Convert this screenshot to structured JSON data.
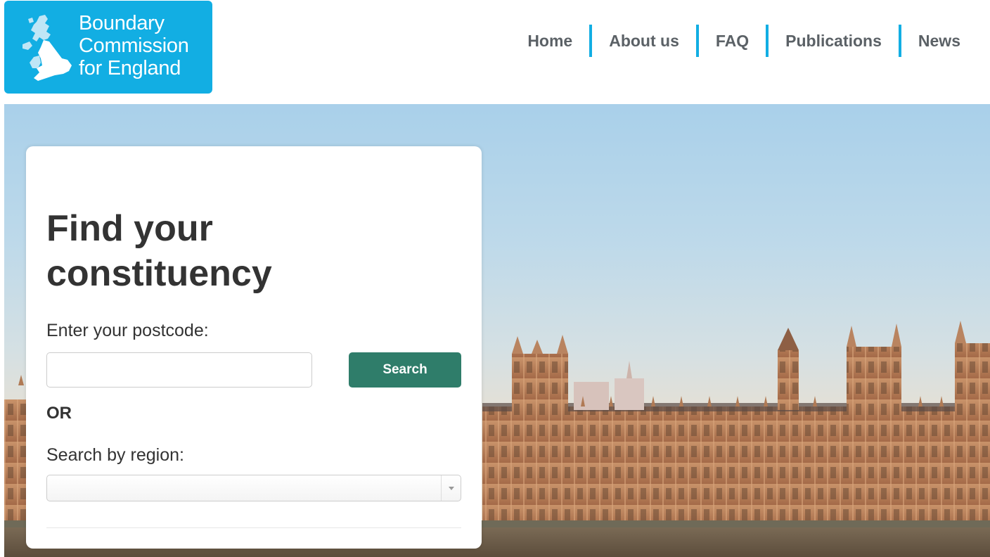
{
  "logo": {
    "line1": "Boundary",
    "line2": "Commission",
    "line3": "for England",
    "map_icon": "uk-map-icon"
  },
  "nav": {
    "items": [
      {
        "label": "Home"
      },
      {
        "label": "About us"
      },
      {
        "label": "FAQ"
      },
      {
        "label": "Publications"
      },
      {
        "label": "News"
      }
    ]
  },
  "search_panel": {
    "title": "Find your constituency",
    "postcode_label": "Enter your postcode:",
    "postcode_value": "",
    "search_button_label": "Search",
    "or_label": "OR",
    "region_label": "Search by region:",
    "region_selected": ""
  },
  "colors": {
    "brand_blue": "#12aee3",
    "button_green": "#2f7d6a",
    "nav_text": "#5b6166",
    "heading_text": "#333333"
  },
  "hero": {
    "image": "houses-of-parliament-photo"
  }
}
